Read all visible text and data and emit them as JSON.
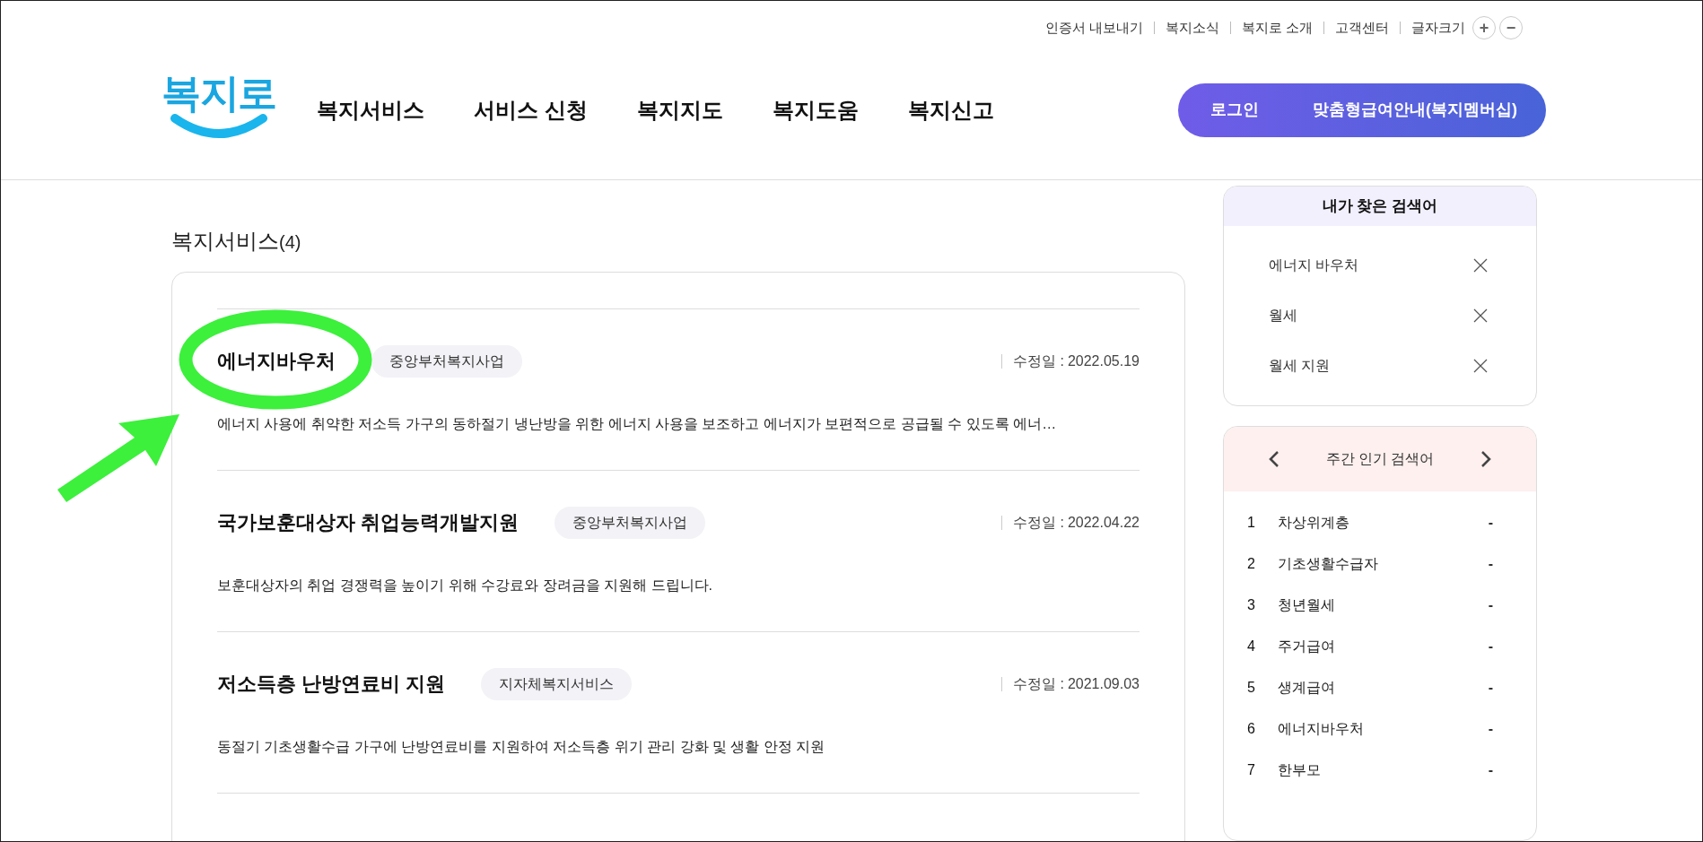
{
  "utility_links": [
    "인증서 내보내기",
    "복지소식",
    "복지로 소개",
    "고객센터"
  ],
  "font_size": {
    "label": "글자크기",
    "increase": "+",
    "decrease": "−"
  },
  "logo": "복지로",
  "nav": [
    "복지서비스",
    "서비스 신청",
    "복지지도",
    "복지도움",
    "복지신고"
  ],
  "account_button": {
    "login": "로그인",
    "membership": "맞춤형급여안내(복지멤버십)"
  },
  "results": {
    "heading": "복지서비스",
    "count": "(4)",
    "items": [
      {
        "title": "에너지바우처",
        "tag": "중앙부처복지사업",
        "date_label": "수정일 :",
        "date": "2022.05.19",
        "description": "에너지 사용에 취약한 저소득 가구의 동하절기 냉난방을 위한 에너지 사용을 보조하고 에너지가 보편적으로 공급될 수 있도록 에너…"
      },
      {
        "title": "국가보훈대상자 취업능력개발지원",
        "tag": "중앙부처복지사업",
        "date_label": "수정일 :",
        "date": "2022.04.22",
        "description": "보훈대상자의 취업 경쟁력을 높이기 위해 수강료와 장려금을 지원해 드립니다."
      },
      {
        "title": "저소득층 난방연료비 지원",
        "tag": "지자체복지서비스",
        "date_label": "수정일 :",
        "date": "2021.09.03",
        "description": "동절기 기초생활수급 가구에 난방연료비를 지원하여 저소득층 위기 관리 강화 및 생활 안정 지원"
      }
    ]
  },
  "recent_searches": {
    "title": "내가 찾은 검색어",
    "items": [
      "에너지 바우처",
      "월세",
      "월세 지원"
    ]
  },
  "weekly_popular": {
    "title": "주간 인기 검색어",
    "items": [
      {
        "rank": "1",
        "term": "차상위계층",
        "change": "-"
      },
      {
        "rank": "2",
        "term": "기초생활수급자",
        "change": "-"
      },
      {
        "rank": "3",
        "term": "청년월세",
        "change": "-"
      },
      {
        "rank": "4",
        "term": "주거급여",
        "change": "-"
      },
      {
        "rank": "5",
        "term": "생계급여",
        "change": "-"
      },
      {
        "rank": "6",
        "term": "에너지바우처",
        "change": "-"
      },
      {
        "rank": "7",
        "term": "한부모",
        "change": "-"
      }
    ]
  }
}
